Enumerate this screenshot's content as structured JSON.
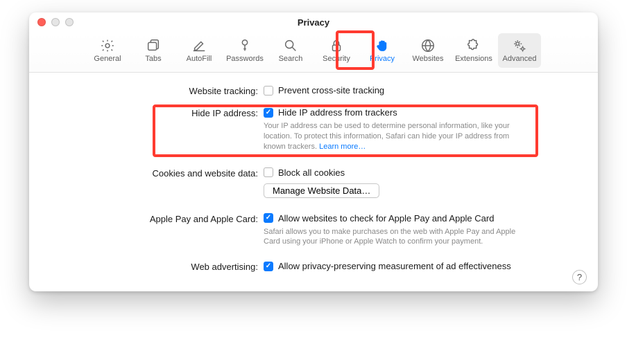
{
  "window": {
    "title": "Privacy"
  },
  "toolbar": {
    "items": [
      {
        "id": "general",
        "label": "General"
      },
      {
        "id": "tabs",
        "label": "Tabs"
      },
      {
        "id": "autofill",
        "label": "AutoFill"
      },
      {
        "id": "passwords",
        "label": "Passwords"
      },
      {
        "id": "search",
        "label": "Search"
      },
      {
        "id": "security",
        "label": "Security"
      },
      {
        "id": "privacy",
        "label": "Privacy"
      },
      {
        "id": "websites",
        "label": "Websites"
      },
      {
        "id": "extensions",
        "label": "Extensions"
      },
      {
        "id": "advanced",
        "label": "Advanced"
      }
    ],
    "selected_index": 6
  },
  "sections": {
    "website_tracking": {
      "label": "Website tracking:",
      "checkbox_label": "Prevent cross-site tracking",
      "checked": false
    },
    "hide_ip": {
      "label": "Hide IP address:",
      "checkbox_label": "Hide IP address from trackers",
      "checked": true,
      "desc": "Your IP address can be used to determine personal information, like your location. To protect this information, Safari can hide your IP address from known trackers. ",
      "learn_more": "Learn more…"
    },
    "cookies": {
      "label": "Cookies and website data:",
      "checkbox_label": "Block all cookies",
      "checked": false,
      "button": "Manage Website Data…"
    },
    "apple_pay": {
      "label": "Apple Pay and Apple Card:",
      "checkbox_label": "Allow websites to check for Apple Pay and Apple Card",
      "checked": true,
      "desc": "Safari allows you to make purchases on the web with Apple Pay and Apple Card using your iPhone or Apple Watch to confirm your payment."
    },
    "web_adv": {
      "label": "Web advertising:",
      "checkbox_label": "Allow privacy-preserving measurement of ad effectiveness",
      "checked": true
    }
  },
  "help_label": "?"
}
